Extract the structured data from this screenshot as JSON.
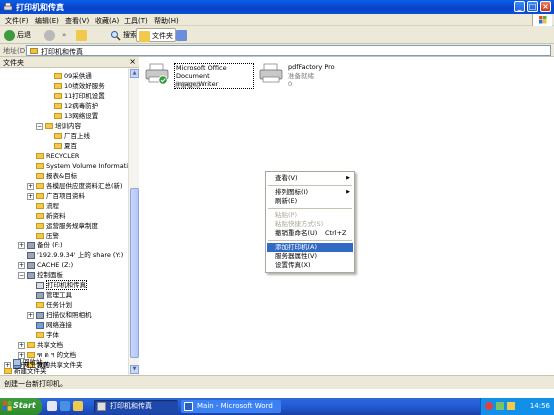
{
  "window": {
    "title": "打印机和传真",
    "controls": {
      "minimize": "_",
      "maximize": "□",
      "close": "×"
    }
  },
  "menu": [
    "文件(F)",
    "编辑(E)",
    "查看(V)",
    "收藏(A)",
    "工具(T)",
    "帮助(H)"
  ],
  "toolbar": {
    "back_label": "后退",
    "forward_symbol": "»",
    "search_label": "搜索",
    "folders_label": "文件夹"
  },
  "address": {
    "label": "地址(D)",
    "value": "打印机和传真"
  },
  "folders_pane": {
    "title": "文件夹",
    "close_symbol": "×",
    "nodes": [
      "09采供通",
      "10绩效好服务",
      "11打印机设置",
      "12病毒防护",
      "13网络设置",
      "培训内容",
      "厂百上线",
      "夏百",
      "RECYCLER",
      "System Volume Information",
      "报表&目标",
      "各模层供应度资料汇总(新)",
      "广百项目资料",
      "流程",
      "新资料",
      "运营服务规章制度",
      "压警",
      "备份 (F:)",
      "'192.9.9.34' 上的 share (Y:)",
      "CACHE (Z:)",
      "控制面板",
      "打印机和传真",
      "管理工具",
      "任务计划",
      "扫描仪和照相机",
      "网络连接",
      "字体",
      "共享文档",
      "ฑ ด ฯ 的文档",
      "我的共享文件夹",
      "网上邻居",
      "回收站",
      "新建文件夹"
    ],
    "expand_symbol": "+",
    "collapse_symbol": "−"
  },
  "printers": [
    {
      "name_line1": "Microsoft Office Document",
      "name_line2": "Image Writer",
      "status": "准备就绪",
      "jobs": ""
    },
    {
      "name_line1": "pdfFactory Pro",
      "name_line2": "",
      "status": "准备就绪",
      "jobs": "0"
    }
  ],
  "context_menu": {
    "items": [
      {
        "label": "查看(V)",
        "submenu": true
      },
      {
        "label": "排列图标(I)",
        "submenu": true
      },
      {
        "label": "刷新(E)"
      },
      {
        "label": "粘贴(P)",
        "disabled": true
      },
      {
        "label": "粘贴快捷方式(S)",
        "disabled": true
      },
      {
        "label": "撤销重命名(U)",
        "shortcut": "Ctrl+Z"
      },
      {
        "label": "添加打印机(A)",
        "highlighted": true
      },
      {
        "label": "服务器属性(V)"
      },
      {
        "label": "设置传真(X)"
      }
    ],
    "submenu_arrow": "▶"
  },
  "status_bar": {
    "text": "创建一台新打印机。"
  },
  "taskbar": {
    "start_label": "Start",
    "tasks": [
      {
        "label": "打印机和传真",
        "active": true
      },
      {
        "label": "Main - Microsoft Word",
        "active": false
      }
    ],
    "clock": "14:56"
  },
  "colors": {
    "xp_blue": "#0842c6",
    "menu_highlight": "#316ac5",
    "chrome": "#ece9d8",
    "start_green": "#2f8a2f"
  }
}
